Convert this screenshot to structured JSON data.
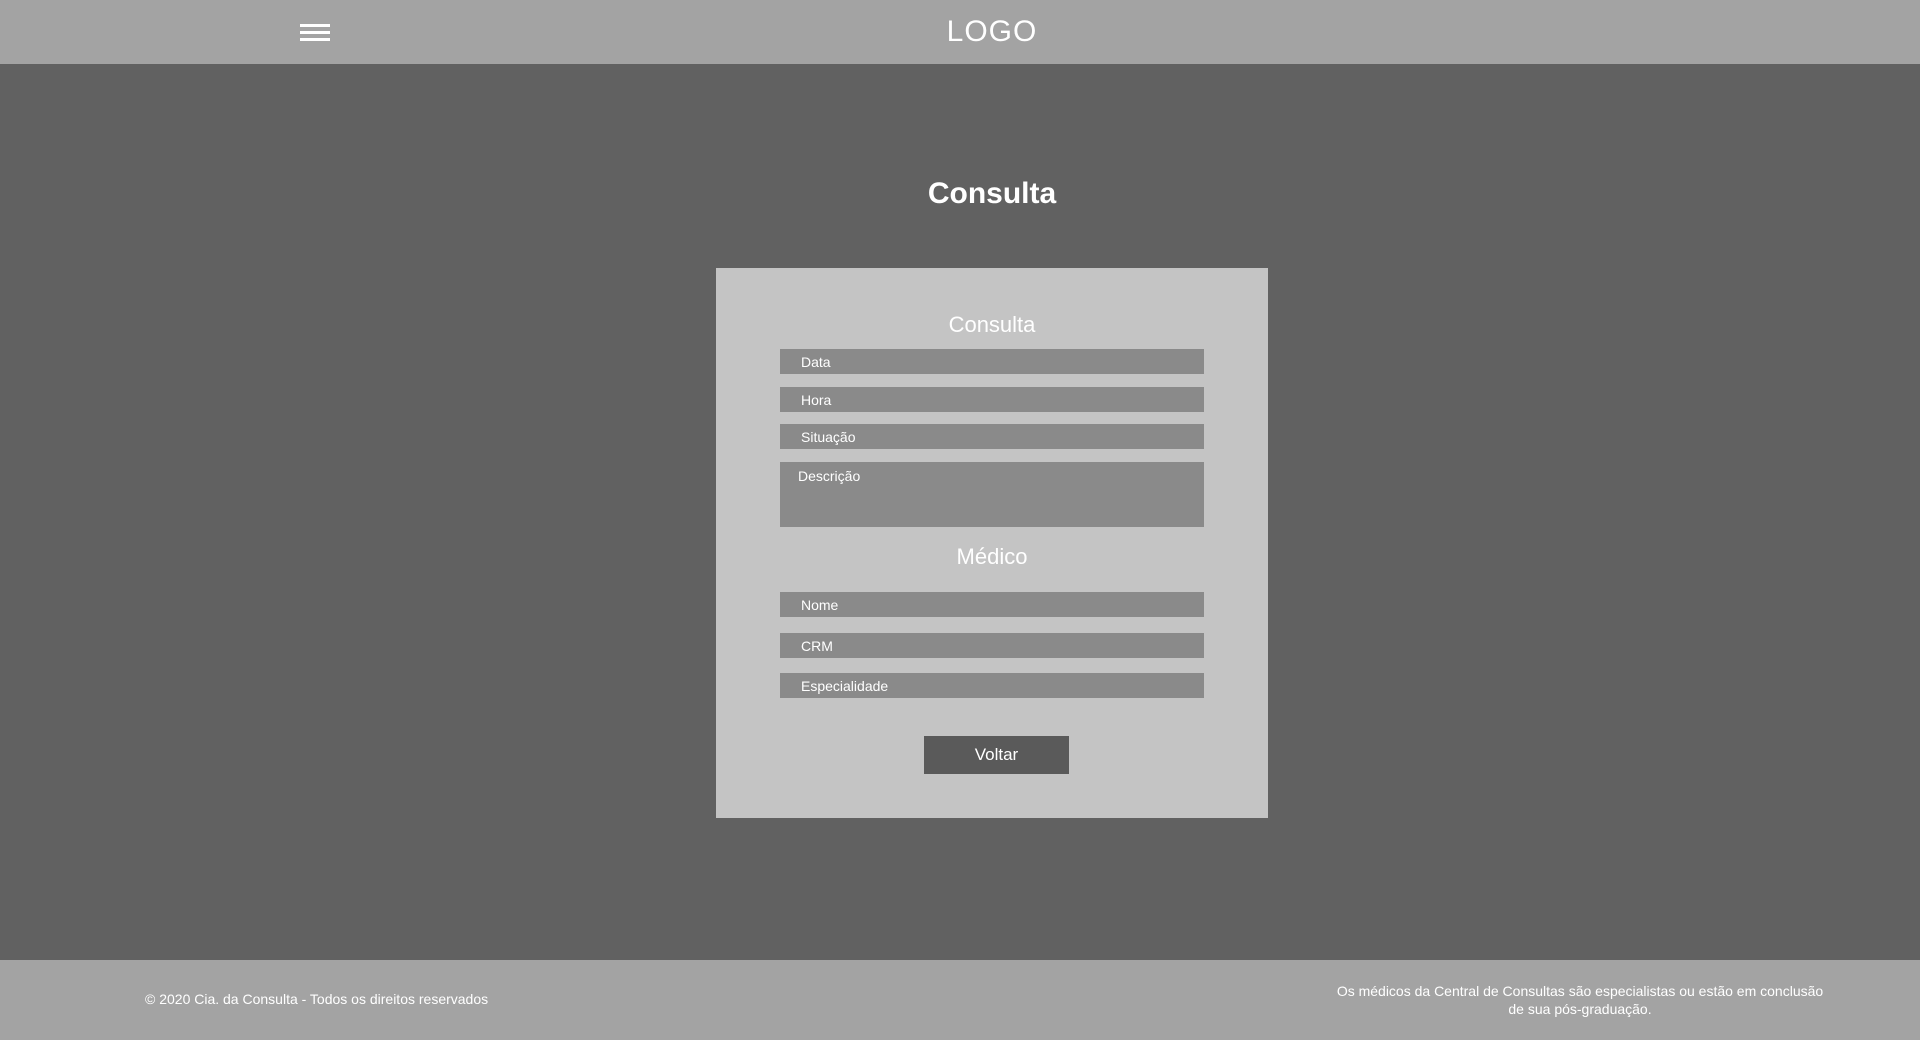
{
  "header": {
    "menu_icon": "hamburger-menu-icon",
    "logo": "LOGO"
  },
  "main": {
    "title": "Consulta"
  },
  "card": {
    "consulta_section": {
      "title": "Consulta",
      "fields": {
        "data": "Data",
        "hora": "Hora",
        "situacao": "Situação",
        "descricao": "Descrição"
      }
    },
    "medico_section": {
      "title": "Médico",
      "fields": {
        "nome": "Nome",
        "crm": "CRM",
        "especialidade": "Especialidade"
      }
    },
    "back_button": "Voltar"
  },
  "footer": {
    "copyright": "© 2020 Cia. da Consulta - Todos os direitos reservados",
    "disclaimer_line1": "Os médicos da Central de Consultas são especialistas ou estão em conclusão",
    "disclaimer_line2": "de sua pós-graduação."
  },
  "colors": {
    "header_bg": "#a3a3a3",
    "page_bg": "#616161",
    "card_bg": "#c4c4c4",
    "field_bg": "#8a8a8a",
    "button_bg": "#5a5a5a",
    "text": "#ffffff"
  }
}
